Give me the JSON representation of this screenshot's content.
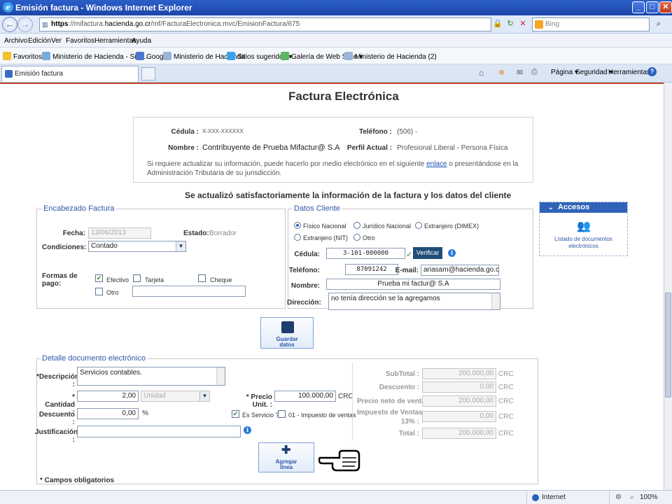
{
  "window": {
    "title": "Emisión factura - Windows Internet Explorer"
  },
  "address": {
    "protocol": "https",
    "url_prefix": "://mifactura.",
    "domain": "hacienda.go.cr",
    "url_path": "/mf/FacturaElectronica.mvc/EmisionFactura/675",
    "search_placeholder": "Bing"
  },
  "menu": [
    "Archivo",
    "Edición",
    "Ver",
    "Favoritos",
    "Herramientas",
    "Ayuda"
  ],
  "favorites": {
    "label": "Favoritos",
    "items": [
      "Ministerio de Hacienda - Sist...",
      "Google",
      "Ministerio de Hacienda",
      "Sitios sugeridos ▾",
      "Galería de Web Slice ▾",
      "Ministerio de Hacienda (2)"
    ]
  },
  "tab": {
    "label": "Emisión factura"
  },
  "commands": [
    "Página ▾",
    "Seguridad ▾",
    "Herramientas ▾"
  ],
  "page": {
    "title": "Factura Electrónica",
    "info": {
      "cedula_label": "Cédula :",
      "cedula_value": "X-XXX-XXXXXX",
      "nombre_label": "Nombre :",
      "nombre_value": "Contribuyente de Prueba Mifactur@ S.A",
      "telefono_label": "Teléfono :",
      "telefono_value": "(506) -",
      "perfil_label": "Perfil Actual :",
      "perfil_value": "Profesional Liberal - Persona Física",
      "note_before": "Si requiere actualizar su información, puede hacerlo por medio electrónico en el siguiente ",
      "note_link": "enlace",
      "note_after": " o presentándose en la Administración Tributaria de su jurisdicción."
    },
    "success_message": "Se actualizó satisfactoriamente la información de la factura y los datos del cliente",
    "encabezado": {
      "legend": "Encabezado Factura",
      "fecha_label": "Fecha:",
      "fecha_value": "13/06/2013",
      "estado_label": "Estado:",
      "estado_value": "Borrador",
      "condiciones_label": "Condiciones:",
      "condiciones_value": "Contado",
      "formas_label": "Formas de pago:",
      "pago_efectivo": "Efectivo",
      "pago_tarjeta": "Tarjeta",
      "pago_cheque": "Cheque",
      "pago_otro": "Otro"
    },
    "cliente": {
      "legend": "Datos Cliente",
      "tipo_fisico": "Físico Nacional",
      "tipo_juridico": "Jurídico Nacional",
      "tipo_extranjero_dimex": "Extranjero (DIMEX)",
      "tipo_extranjero_nit": "Extranjero (NIT)",
      "tipo_otro": "Otro",
      "cedula_label": "Cédula:",
      "cedula_value": "3-101-000000",
      "verificar_label": "Verificar",
      "telefono_label": "Teléfono:",
      "telefono_value": "87091242",
      "email_label": "E-mail:",
      "email_value": "ariasam@hacienda.go.cr",
      "nombre_label": "Nombre:",
      "nombre_value": "Prueba mi factur@ S.A",
      "direccion_label": "Dirección:",
      "direccion_value": "no tenía dirección se la agregamos"
    },
    "guardar_label_1": "Guardar",
    "guardar_label_2": "datos",
    "accesos": {
      "header": "Accesos",
      "link_1": "Listado de documentos",
      "link_2": "electrónicos"
    },
    "detalle": {
      "legend": "Detalle documento electrónico",
      "descripcion_label": "*Descripción :",
      "descripcion_value": "Servicios contables.",
      "cantidad_label": "* Cantidad :",
      "cantidad_value": "2,00",
      "unidad_value": "Unidad",
      "precio_label": "* Precio Unit. :",
      "precio_value": "100.000,00",
      "precio_currency": "CRC",
      "descuento_label": "Descuento :",
      "descuento_value": "0,00",
      "descuento_unit": "%",
      "servicio_label": "Es Servicio ?",
      "impuesto_label": "01 - Impuesto de ventas",
      "justificacion_label": "Justificación :",
      "subtotal_label": "SubTotal :",
      "subtotal_value": "200.000,00",
      "desc_total_label": "Descuento :",
      "desc_total_value": "0,00",
      "precio_neto_label": "Precio neto de venta :",
      "precio_neto_value": "200.000,00",
      "impuesto_ventas_label_1": "Impuesto de Ventas",
      "impuesto_ventas_label_2": "13% :",
      "impuesto_ventas_value": "0,00",
      "total_label": "Total :",
      "total_value": "200.000,00",
      "currency": "CRC",
      "agregar_label_1": "Agregar",
      "agregar_label_2": "línea"
    },
    "required_note": "* Campos obligatorios"
  },
  "status": {
    "zone": "Internet",
    "zoom": "100%"
  }
}
